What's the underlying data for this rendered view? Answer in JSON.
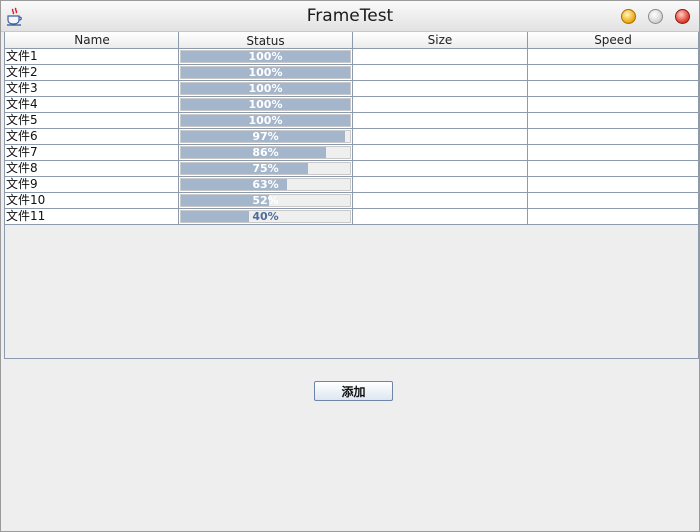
{
  "window": {
    "title": "FrameTest"
  },
  "table": {
    "columns": [
      "Name",
      "Status",
      "Size",
      "Speed"
    ],
    "rows": [
      {
        "name": "文件1",
        "progress": 100,
        "status": "100%",
        "size": "",
        "speed": ""
      },
      {
        "name": "文件2",
        "progress": 100,
        "status": "100%",
        "size": "",
        "speed": ""
      },
      {
        "name": "文件3",
        "progress": 100,
        "status": "100%",
        "size": "",
        "speed": ""
      },
      {
        "name": "文件4",
        "progress": 100,
        "status": "100%",
        "size": "",
        "speed": ""
      },
      {
        "name": "文件5",
        "progress": 100,
        "status": "100%",
        "size": "",
        "speed": ""
      },
      {
        "name": "文件6",
        "progress": 97,
        "status": "97%",
        "size": "",
        "speed": ""
      },
      {
        "name": "文件7",
        "progress": 86,
        "status": "86%",
        "size": "",
        "speed": ""
      },
      {
        "name": "文件8",
        "progress": 75,
        "status": "75%",
        "size": "",
        "speed": ""
      },
      {
        "name": "文件9",
        "progress": 63,
        "status": "63%",
        "size": "",
        "speed": ""
      },
      {
        "name": "文件10",
        "progress": 52,
        "status": "52%",
        "size": "",
        "speed": ""
      },
      {
        "name": "文件11",
        "progress": 40,
        "status": "40%",
        "size": "",
        "speed": ""
      }
    ]
  },
  "actions": {
    "add_label": "添加"
  },
  "icons": {
    "app": "java-cup-icon",
    "minimize": "minimize-icon",
    "maximize": "maximize-icon",
    "close": "close-icon"
  },
  "colors": {
    "progress_fill": "#a4b6cc",
    "grid_line": "#8d9aad",
    "window_bg": "#eeeeee"
  }
}
